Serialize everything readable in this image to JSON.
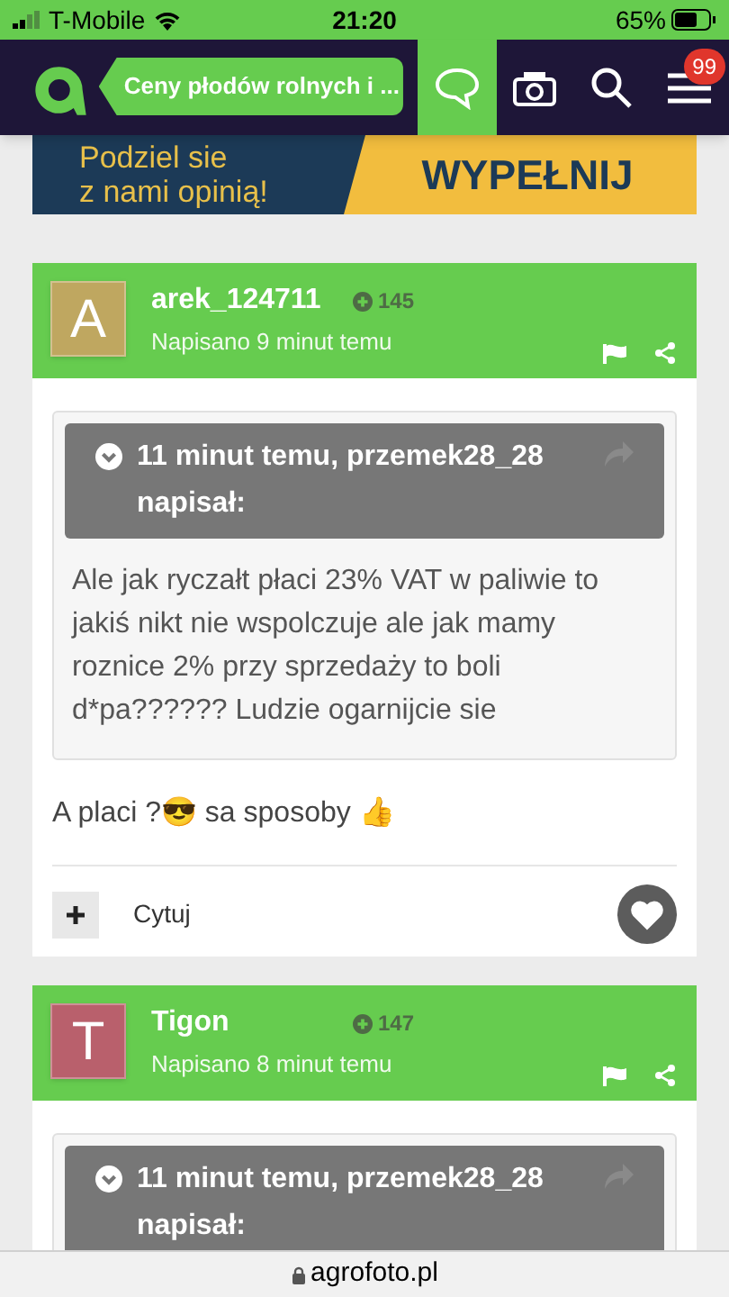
{
  "status_bar": {
    "carrier": "T-Mobile",
    "time": "21:20",
    "battery": "65%"
  },
  "nav": {
    "title": "Ceny płodów rolnych i ...",
    "buttons": [
      {
        "kind": "chat",
        "selected": true
      },
      {
        "kind": "camera",
        "selected": false
      },
      {
        "kind": "search",
        "selected": false
      },
      {
        "kind": "menu",
        "selected": false,
        "badge": "99"
      }
    ]
  },
  "banner": {
    "lines": [
      "Podziel sie",
      "z nami opinią!"
    ],
    "action": "WYPEŁNIJ"
  },
  "posts": [
    {
      "avatar": "A",
      "color": "#bfa760",
      "author": "arek_124711",
      "reputation": "145",
      "posted": "Napisano 9 minut temu",
      "quote": {
        "header": "11 minut temu, przemek28_28 napisał:",
        "text": "Ale jak ryczałt płaci 23% VAT w paliwie to jakiś nikt nie wspolczuje ale jak mamy roznice 2% przy sprzedaży to boli d*pa?????? Ludzie ogarnijcie sie"
      },
      "body": "A placi ?😎 sa sposoby 👍",
      "quote_action": "Cytuj"
    },
    {
      "avatar": "T",
      "color": "#b9606c",
      "author": "Tigon",
      "reputation": "147",
      "posted": "Napisano 8 minut temu",
      "quote": {
        "header": "11 minut temu, przemek28_28 napisał:"
      }
    }
  ],
  "url_bar": {
    "address": "agrofoto.pl"
  }
}
